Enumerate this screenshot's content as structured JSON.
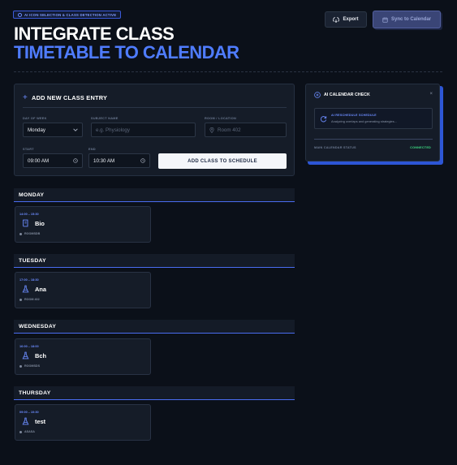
{
  "header": {
    "badge": "AI ICON SELECTION & CLASS DETECTION ACTIVE",
    "title_line1": "INTEGRATE CLASS",
    "title_line2": "TIMETABLE TO CALENDAR",
    "export_label": "Export",
    "sync_label": "Sync to Calendar"
  },
  "form": {
    "heading": "ADD NEW CLASS ENTRY",
    "day_label": "DAY OF WEEK",
    "day_value": "Monday",
    "subject_label": "SUBJECT NAME",
    "subject_placeholder": "e.g. Physiology",
    "room_label": "ROOM / LOCATION",
    "room_placeholder": "Room 402",
    "start_label": "START",
    "start_value": "09:00 AM",
    "end_label": "END",
    "end_value": "10:30 AM",
    "add_button": "ADD CLASS TO SCHEDULE"
  },
  "ai_panel": {
    "title": "AI CALENDAR CHECK",
    "close": "×",
    "box_title": "AI RESCHEDULE SCHEDULE",
    "box_text": "Analyzing overlaps and generating strategies...",
    "status_label": "MAIN CALENDAR STATUS",
    "status_value": "CONNECTED",
    "status_color": "#3ddc84"
  },
  "days": [
    {
      "name": "MONDAY",
      "time": "14:00 – 15:30",
      "class": "Bio",
      "room": "ROOMSDB"
    },
    {
      "name": "TUESDAY",
      "time": "17:00 – 18:30",
      "class": "Ana",
      "room": "ROOM 402"
    },
    {
      "name": "WEDNESDAY",
      "time": "16:00 – 18:00",
      "class": "Bch",
      "room": "ROOMSDS"
    },
    {
      "name": "THURSDAY",
      "time": "09:00 – 10:30",
      "class": "test",
      "room": "ASASA"
    }
  ],
  "colors": {
    "accent": "#4f7cff",
    "background": "#0b1019"
  }
}
